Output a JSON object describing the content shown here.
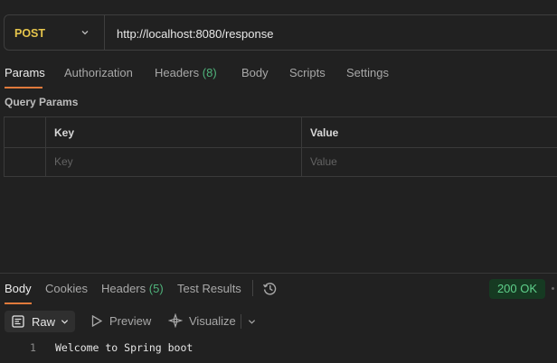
{
  "request": {
    "method": "POST",
    "url": "http://localhost:8080/response"
  },
  "request_tabs": [
    {
      "label": "Params"
    },
    {
      "label": "Authorization"
    },
    {
      "label": "Headers",
      "count": "(8)"
    },
    {
      "label": "Body"
    },
    {
      "label": "Scripts"
    },
    {
      "label": "Settings"
    }
  ],
  "query_params": {
    "title": "Query Params",
    "columns": {
      "key": "Key",
      "value": "Value"
    },
    "placeholders": {
      "key": "Key",
      "value": "Value"
    }
  },
  "response_tabs": [
    {
      "label": "Body"
    },
    {
      "label": "Cookies"
    },
    {
      "label": "Headers",
      "count": "(5)"
    },
    {
      "label": "Test Results"
    }
  ],
  "response": {
    "status": "200 OK",
    "format": "Raw",
    "preview_label": "Preview",
    "visualize_label": "Visualize",
    "lines": [
      {
        "number": "1",
        "text": "Welcome to Spring boot"
      }
    ]
  },
  "colors": {
    "method": "#e6c54c",
    "accent": "#e07a3c",
    "count": "#4fb37b",
    "status_ok": "#5fd08b"
  },
  "icons": [
    "chevron-down-icon",
    "history-icon",
    "raw-format-icon",
    "play-icon",
    "visualize-icon"
  ]
}
